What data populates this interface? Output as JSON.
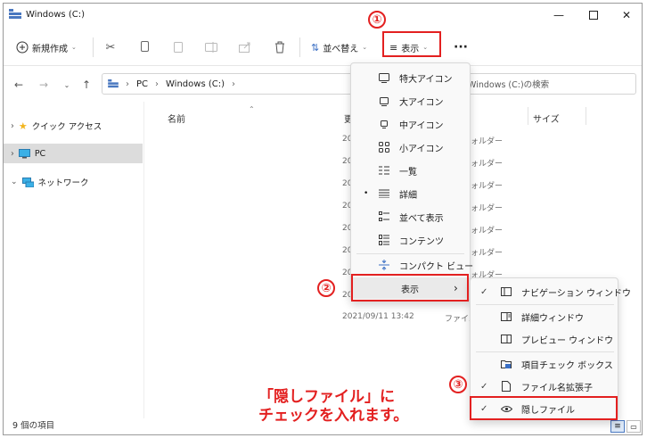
{
  "window": {
    "title": "Windows (C:)"
  },
  "toolbar": {
    "new_label": "新規作成",
    "sort_label": "並べ替え",
    "view_label": "表示",
    "more_label": "···"
  },
  "address": {
    "path": [
      "PC",
      "Windows (C:)"
    ],
    "search_placeholder": "Windows (C:)の検索"
  },
  "nav": {
    "items": [
      {
        "label": "クイック アクセス"
      },
      {
        "label": "PC"
      },
      {
        "label": "ネットワーク"
      }
    ]
  },
  "columns": {
    "name": "名前",
    "date": "更",
    "size": "サイズ"
  },
  "rows": [
    {
      "date": "20",
      "type": "フォルダー"
    },
    {
      "date": "20",
      "type": "フォルダー"
    },
    {
      "date": "20",
      "type": "フォルダー"
    },
    {
      "date": "20",
      "type": "フォルダー"
    },
    {
      "date": "20",
      "type": "フォルダー"
    },
    {
      "date": "20",
      "type": "フォルダー"
    },
    {
      "date": "20",
      "type": "フォルダー"
    },
    {
      "date": "20",
      "type": "フォルダー"
    },
    {
      "date": "2021/09/11 13:42",
      "type": "ファイル"
    }
  ],
  "status": {
    "count": "9 個の項目"
  },
  "view_menu": {
    "items": [
      {
        "label": "特大アイコン",
        "icon": "monitor-icon"
      },
      {
        "label": "大アイコン",
        "icon": "monitor-icon"
      },
      {
        "label": "中アイコン",
        "icon": "monitor-icon"
      },
      {
        "label": "小アイコン",
        "icon": "grid-icon"
      },
      {
        "label": "一覧",
        "icon": "list-icon"
      },
      {
        "label": "詳細",
        "icon": "details-icon"
      },
      {
        "label": "並べて表示",
        "icon": "tiles-icon"
      },
      {
        "label": "コンテンツ",
        "icon": "content-icon"
      },
      {
        "label": "コンパクト ビュー",
        "icon": "compact-icon"
      }
    ],
    "show_label": "表示"
  },
  "show_submenu": {
    "items": [
      {
        "label": "ナビゲーション ウィンドウ",
        "checked": true
      },
      {
        "label": "詳細ウィンドウ",
        "checked": false
      },
      {
        "label": "プレビュー ウィンドウ",
        "checked": false
      },
      {
        "label": "項目チェック ボックス",
        "checked": false
      },
      {
        "label": "ファイル名拡張子",
        "checked": true
      },
      {
        "label": "隠しファイル",
        "checked": true
      }
    ]
  },
  "annotations": {
    "step1": "①",
    "step2": "②",
    "step3": "③",
    "note_line1": "「隠しファイル」に",
    "note_line2": "チェックを入れます。"
  },
  "colors": {
    "accent_red": "#e32020",
    "selected_bg": "#dcdcdc"
  }
}
